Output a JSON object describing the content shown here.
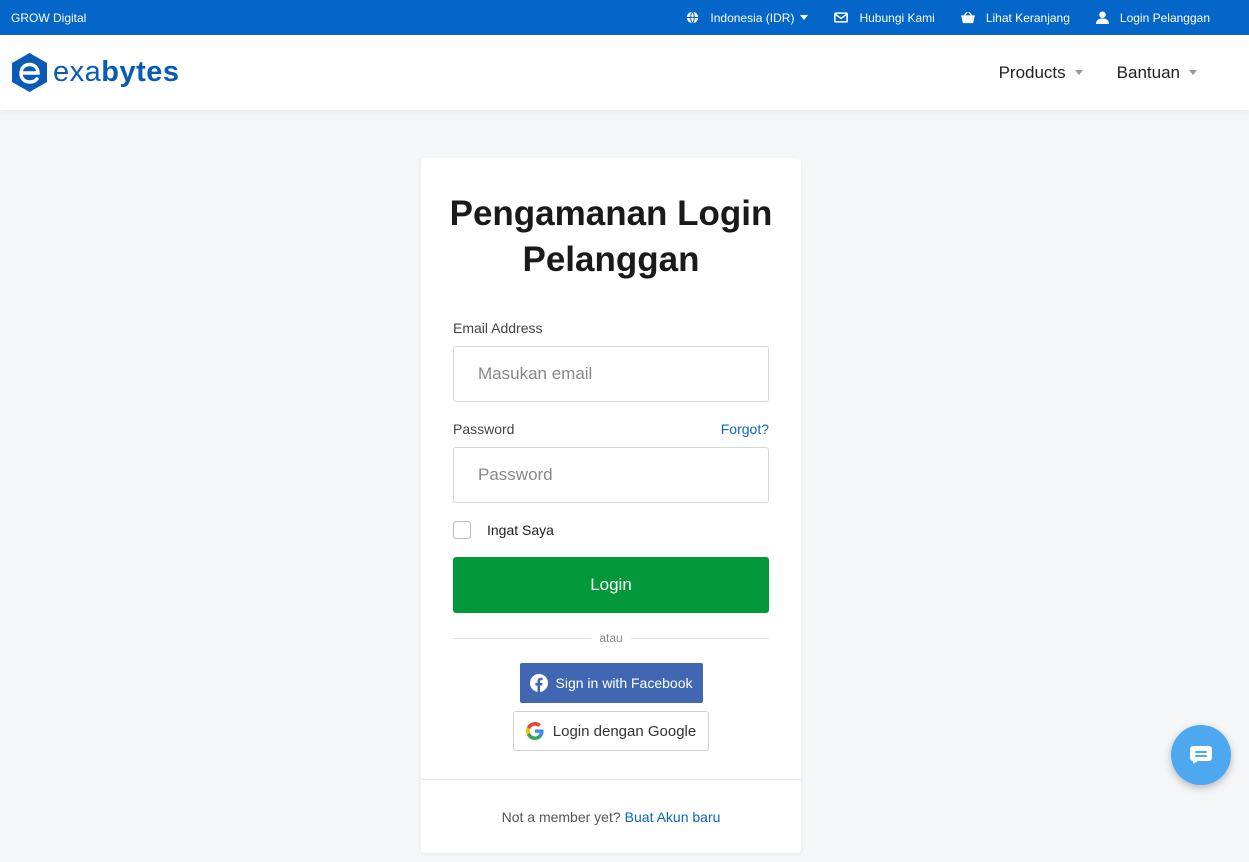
{
  "topbar": {
    "brand": "GROW Digital",
    "currency": "Indonesia (IDR)",
    "contact": "Hubungi Kami",
    "cart": "Lihat Keranjang",
    "login": "Login Pelanggan"
  },
  "navbar": {
    "logo_prefix": "exa",
    "logo_suffix": "bytes",
    "items": [
      {
        "label": "Products"
      },
      {
        "label": "Bantuan"
      }
    ]
  },
  "card": {
    "title": "Pengamanan Login Pelanggan",
    "email_label": "Email Address",
    "email_placeholder": "Masukan email",
    "email_value": "",
    "password_label": "Password",
    "forgot": "Forgot?",
    "password_placeholder": "Password",
    "password_value": "",
    "remember": "Ingat Saya",
    "login_button": "Login",
    "divider": "atau",
    "facebook_button": "Sign in with Facebook",
    "google_button": "Login dengan Google",
    "footer_text": "Not a member yet?",
    "footer_link": "Buat Akun baru"
  },
  "colors": {
    "topbar": "#0566c9",
    "login_button": "#03993a",
    "facebook": "#4267b2",
    "link": "#0a66c2",
    "chat": "#4ea8f0"
  },
  "icons": {
    "currency": "globe-icon",
    "contact": "envelope-icon",
    "cart": "basket-icon",
    "login": "user-icon",
    "chat": "chat-bubble-icon"
  }
}
